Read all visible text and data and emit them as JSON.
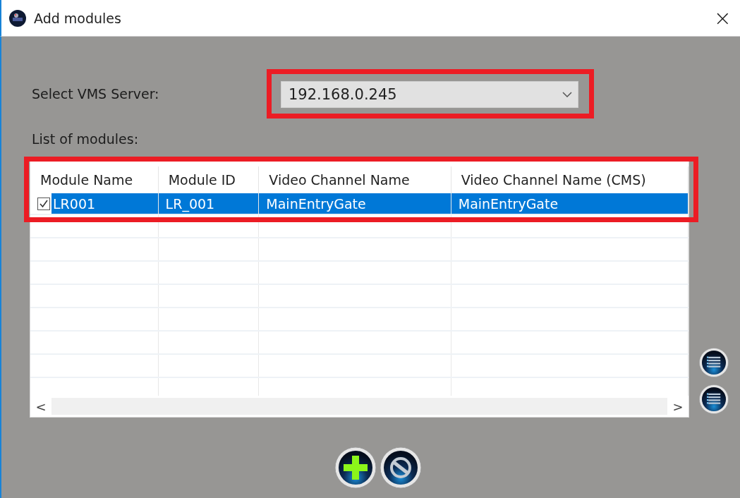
{
  "window": {
    "title": "Add modules",
    "close": "×"
  },
  "server": {
    "label": "Select VMS Server:",
    "value": "192.168.0.245"
  },
  "modules": {
    "label": "List of modules:",
    "columns": [
      "Module Name",
      "Module ID",
      "Video Channel Name",
      "Video Channel Name (CMS)"
    ],
    "rows": [
      {
        "checked": true,
        "selected": true,
        "cells": [
          "LR001",
          "LR_001",
          "MainEntryGate",
          "MainEntryGate"
        ]
      }
    ],
    "scroll_left": "<",
    "scroll_right": ">"
  },
  "side_buttons": [
    {
      "kind": "list"
    },
    {
      "kind": "list"
    }
  ],
  "buttons": [
    {
      "kind": "add"
    },
    {
      "kind": "cancel"
    }
  ]
}
